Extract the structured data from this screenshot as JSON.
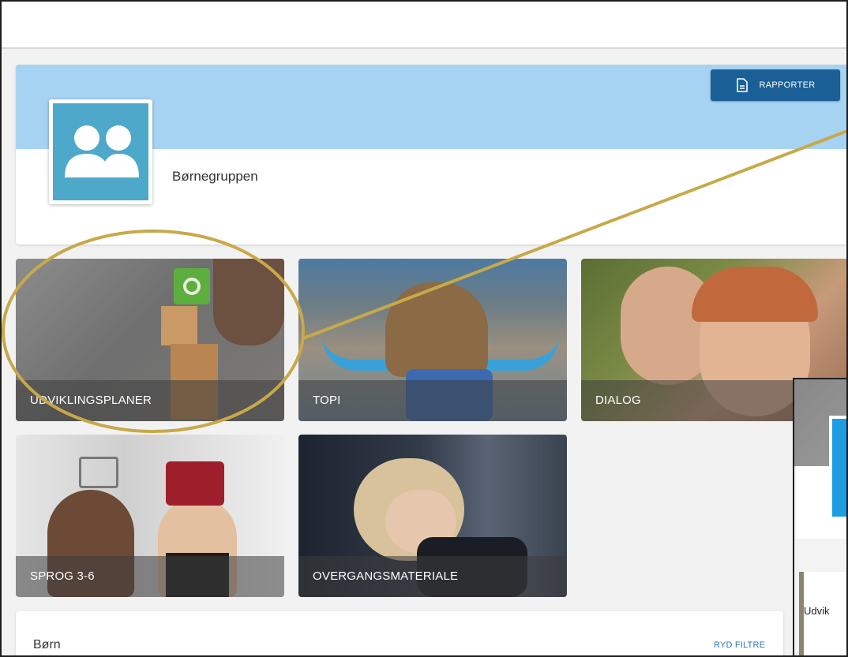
{
  "header": {
    "report_button_label": "RAPPORTER"
  },
  "group": {
    "name": "Børnegruppen",
    "avatar_icon": "users-icon"
  },
  "tiles": [
    {
      "label": "UDVIKLINGSPLANER"
    },
    {
      "label": "TOPI"
    },
    {
      "label": "DIALOG"
    },
    {
      "label": "SPROG 3-6"
    },
    {
      "label": "OVERGANGSMATERIALE"
    }
  ],
  "children_section": {
    "title": "Børn",
    "clear_filters_label": "RYD FILTRE"
  },
  "overlay": {
    "partial_text": "Udvik"
  },
  "colors": {
    "banner": "#a7d3f2",
    "report_button": "#1a6096",
    "avatar_bg": "#4ea8c9",
    "annotation": "#c8a94a",
    "link": "#2a78b8"
  }
}
